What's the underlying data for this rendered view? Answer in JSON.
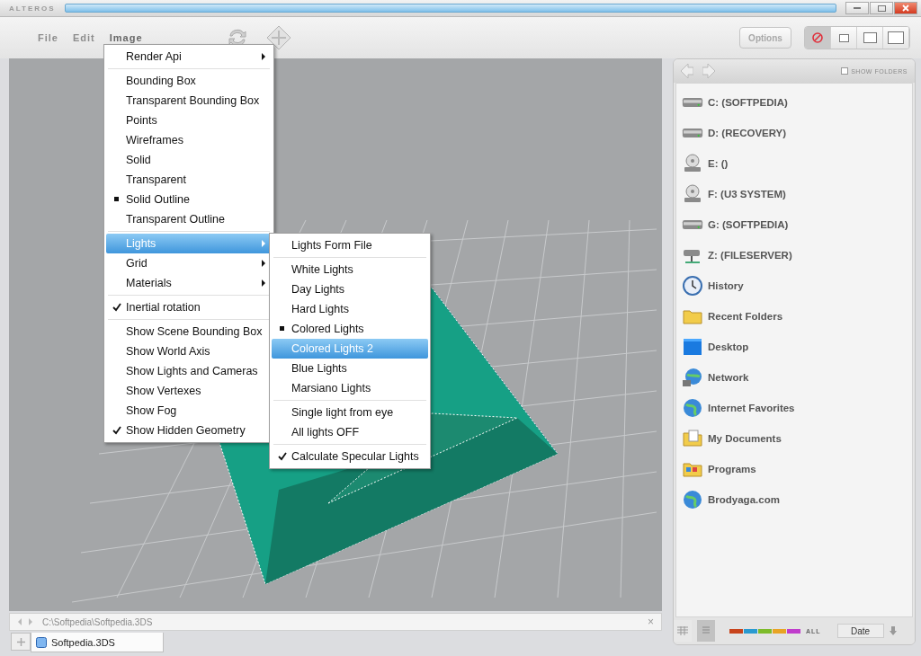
{
  "window": {
    "title": "ALTEROS"
  },
  "menu_bar": [
    {
      "label": "File",
      "selected": false
    },
    {
      "label": "Edit",
      "selected": false
    },
    {
      "label": "Image",
      "selected": true
    }
  ],
  "toolbar": {
    "options_button": "Options",
    "view_modes": [
      {
        "kind": "stop",
        "selected": true
      },
      {
        "kind": "small",
        "selected": false
      },
      {
        "kind": "medium",
        "selected": false
      },
      {
        "kind": "large",
        "selected": false
      }
    ]
  },
  "image_menu": {
    "groups": [
      {
        "items": [
          {
            "label": "Render Api",
            "kind": "submenu",
            "selected": false
          }
        ]
      },
      {
        "items": [
          {
            "label": "Bounding Box",
            "kind": "radio",
            "checked": false
          },
          {
            "label": "Transparent Bounding Box",
            "kind": "radio",
            "checked": false
          },
          {
            "label": "Points",
            "kind": "radio",
            "checked": false
          },
          {
            "label": "Wireframes",
            "kind": "radio",
            "checked": false
          },
          {
            "label": "Solid",
            "kind": "radio",
            "checked": false
          },
          {
            "label": "Transparent",
            "kind": "radio",
            "checked": false
          },
          {
            "label": "Solid Outline",
            "kind": "radio",
            "checked": true
          },
          {
            "label": "Transparent Outline",
            "kind": "radio",
            "checked": false
          }
        ]
      },
      {
        "items": [
          {
            "label": "Lights",
            "kind": "submenu",
            "selected": true
          },
          {
            "label": "Grid",
            "kind": "submenu",
            "selected": false
          },
          {
            "label": "Materials",
            "kind": "submenu",
            "selected": false
          }
        ]
      },
      {
        "items": [
          {
            "label": "Inertial rotation",
            "kind": "check",
            "checked": true
          }
        ]
      },
      {
        "items": [
          {
            "label": "Show Scene Bounding Box",
            "kind": "check",
            "checked": false
          },
          {
            "label": "Show World Axis",
            "kind": "check",
            "checked": false
          },
          {
            "label": "Show Lights and Cameras",
            "kind": "check",
            "checked": false
          },
          {
            "label": "Show Vertexes",
            "kind": "check",
            "checked": false
          },
          {
            "label": "Show Fog",
            "kind": "check",
            "checked": false
          },
          {
            "label": "Show Hidden Geometry",
            "kind": "check",
            "checked": true
          }
        ]
      }
    ]
  },
  "lights_menu": {
    "groups": [
      {
        "items": [
          {
            "label": "Lights Form File",
            "kind": "plain",
            "selected": false
          }
        ]
      },
      {
        "items": [
          {
            "label": "White Lights",
            "kind": "radio",
            "checked": false,
            "selected": false
          },
          {
            "label": "Day Lights",
            "kind": "radio",
            "checked": false,
            "selected": false
          },
          {
            "label": "Hard Lights",
            "kind": "radio",
            "checked": false,
            "selected": false
          },
          {
            "label": "Colored Lights",
            "kind": "radio",
            "checked": true,
            "selected": false
          },
          {
            "label": "Colored Lights 2",
            "kind": "radio",
            "checked": false,
            "selected": true
          },
          {
            "label": "Blue Lights",
            "kind": "radio",
            "checked": false,
            "selected": false
          },
          {
            "label": "Marsiano Lights",
            "kind": "radio",
            "checked": false,
            "selected": false
          }
        ]
      },
      {
        "items": [
          {
            "label": "Single light from eye",
            "kind": "check",
            "checked": false,
            "selected": false
          },
          {
            "label": "All lights OFF",
            "kind": "check",
            "checked": false,
            "selected": false
          }
        ]
      },
      {
        "items": [
          {
            "label": "Calculate Specular Lights",
            "kind": "check",
            "checked": true,
            "selected": false
          }
        ]
      }
    ]
  },
  "path_bar": {
    "path": "C:\\Softpedia\\Softpedia.3DS",
    "close": "×"
  },
  "document_tabs": [
    {
      "label": "Softpedia.3DS",
      "selected": true
    }
  ],
  "browser": {
    "show_folders": {
      "label": "SHOW FOLDERS",
      "checked": false
    },
    "items": [
      {
        "label": "C: (SOFTPEDIA)",
        "kind": "drive"
      },
      {
        "label": "D: (RECOVERY)",
        "kind": "drive"
      },
      {
        "label": "E: ()",
        "kind": "cdrom"
      },
      {
        "label": "F: (U3 SYSTEM)",
        "kind": "cdrom"
      },
      {
        "label": "G: (SOFTPEDIA)",
        "kind": "drive"
      },
      {
        "label": "Z: (FILESERVER)",
        "kind": "netdrive"
      },
      {
        "label": "History",
        "kind": "history"
      },
      {
        "label": "Recent Folders",
        "kind": "folder"
      },
      {
        "label": "Desktop",
        "kind": "desktop"
      },
      {
        "label": "Network",
        "kind": "network"
      },
      {
        "label": "Internet Favorites",
        "kind": "globe"
      },
      {
        "label": "My Documents",
        "kind": "documents"
      },
      {
        "label": "Programs",
        "kind": "programs"
      },
      {
        "label": "Brodyaga.com",
        "kind": "globe"
      }
    ],
    "view_buttons": [
      {
        "kind": "grid",
        "selected": false
      },
      {
        "kind": "list",
        "selected": true
      }
    ],
    "color_filters": [
      {
        "color": "#c8441c"
      },
      {
        "color": "#2a9ad0"
      },
      {
        "color": "#7dbb2a"
      },
      {
        "color": "#e8a424"
      },
      {
        "color": "#c03ccc"
      }
    ],
    "filter_all": "ALL",
    "sort_field": "Date"
  }
}
